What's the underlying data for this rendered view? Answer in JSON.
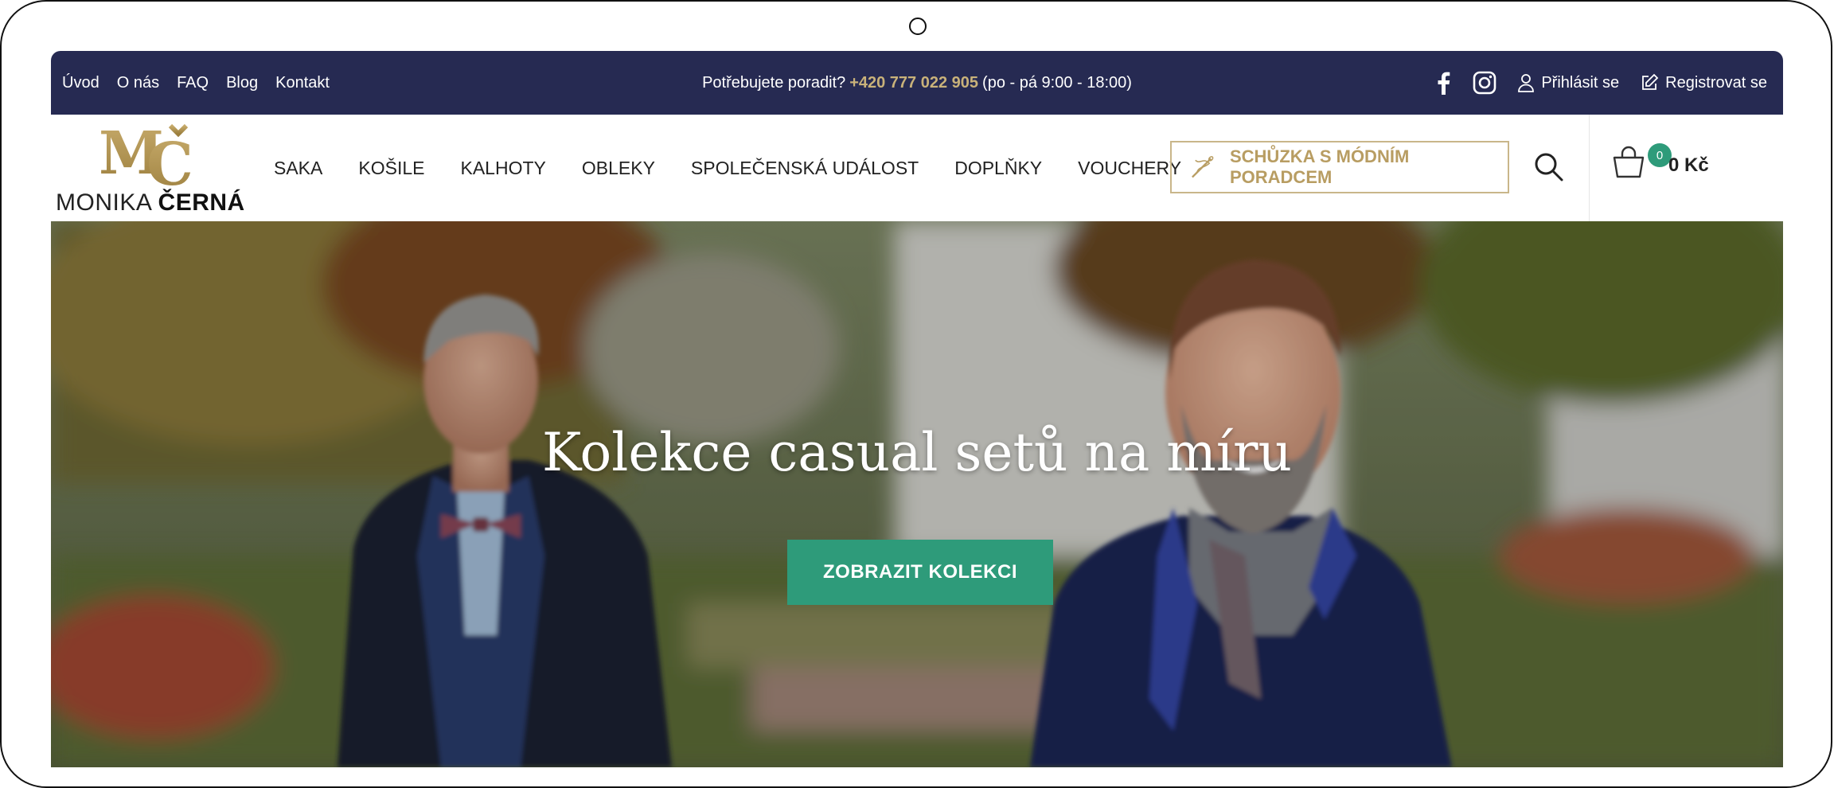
{
  "topbar": {
    "links": [
      "Úvod",
      "O nás",
      "FAQ",
      "Blog",
      "Kontakt"
    ],
    "help_text": "Potřebujete poradit?",
    "phone": "+420 777 022 905",
    "hours": "(po - pá 9:00 - 18:00)",
    "login_label": "Přihlásit se",
    "register_label": "Registrovat se",
    "icons": [
      "facebook-icon",
      "instagram-icon",
      "user-icon",
      "edit-icon"
    ]
  },
  "header": {
    "logo": {
      "mark": "MČ",
      "name_first": "MONIKA",
      "name_last": "ČERNÁ"
    },
    "nav": [
      "SAKA",
      "KOŠILE",
      "KALHOTY",
      "OBLEKY",
      "SPOLEČENSKÁ UDÁLOST",
      "DOPLŇKY",
      "VOUCHERY"
    ],
    "cta_label": "SCHŮZKA S MÓDNÍM PORADCEM",
    "cart_count": "0",
    "cart_total": "0 Kč"
  },
  "hero": {
    "title": "Kolekce casual setů na míru",
    "button_label": "ZOBRAZIT KOLEKCI"
  },
  "colors": {
    "topbar_bg": "#262a52",
    "gold_accent": "#c9b27a",
    "cta_green": "#2e9b7a"
  }
}
